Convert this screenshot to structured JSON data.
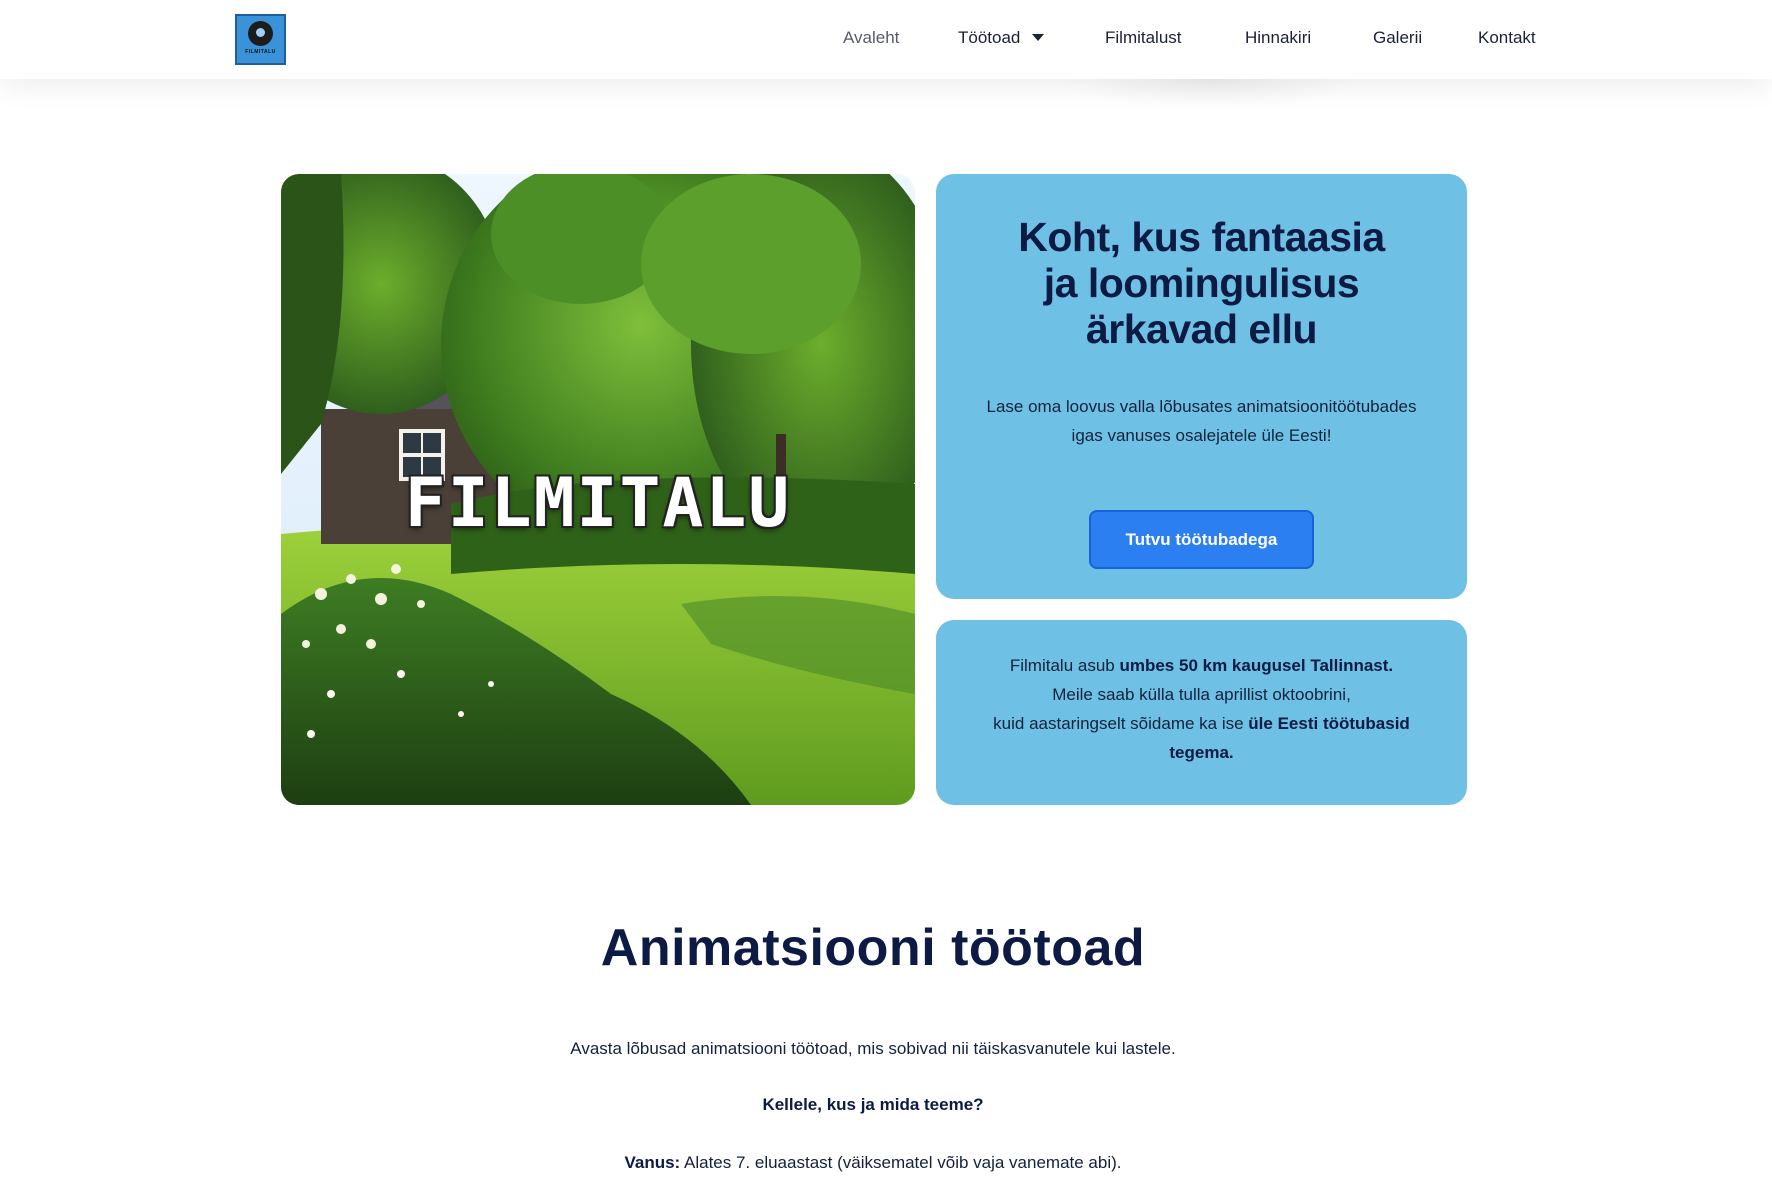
{
  "header": {
    "logo_text": "FILMITALU",
    "nav": [
      {
        "label": "Avaleht",
        "active": true
      },
      {
        "label": "Töötoad",
        "has_dropdown": true
      },
      {
        "label": "Filmitalust"
      },
      {
        "label": "Hinnakiri"
      },
      {
        "label": "Galerii"
      },
      {
        "label": "Kontakt"
      }
    ]
  },
  "hero": {
    "image_title": "FILMITALU",
    "heading_lines": [
      "Koht, kus fantaasia",
      "ja loomingulisus",
      "ärkavad ellu"
    ],
    "subtitle_lines": [
      "Lase oma loovus valla lõbusates animatsioonitöötubades",
      "igas vanuses osalejatele üle Eesti!"
    ],
    "cta_label": "Tutvu töötubadega"
  },
  "info": {
    "line1_prefix": "Filmitalu asub ",
    "line1_bold": "umbes 50 km kaugusel Tallinnast.",
    "line2": "Meile saab külla tulla aprillist oktoobrini,",
    "line3_prefix": "kuid aastaringselt sõidame ka ise ",
    "line3_bold": "üle Eesti töötubasid",
    "line4_bold": "tegema."
  },
  "workshops": {
    "title": "Animatsiooni töötoad",
    "lead": "Avasta lõbusad animatsiooni töötoad, mis sobivad nii täiskasvanutele kui lastele.",
    "question": "Kellele, kus ja mida teeme?",
    "age_label": "Vanus:",
    "age_text": " Alates 7. eluaastast (väiksematel võib vaja vanemate abi)."
  },
  "colors": {
    "card_blue": "#6ec1e4",
    "button_blue": "#2b7ff0",
    "heading_navy": "#0c1a44"
  }
}
